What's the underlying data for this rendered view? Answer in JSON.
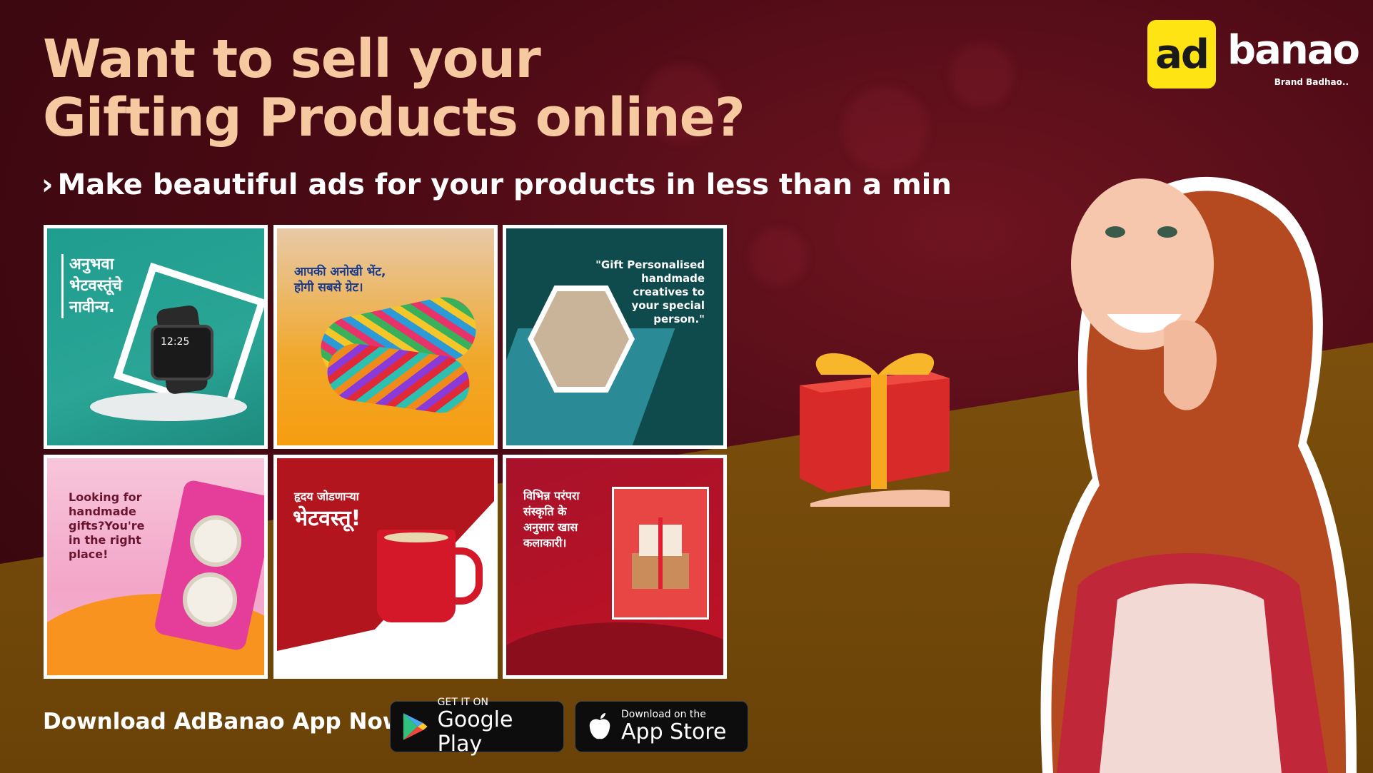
{
  "headline": {
    "line1": "Want to sell your",
    "line2": "Gifting Products online?"
  },
  "subheadline": "Make beautiful ads for your products in less than a min",
  "logo": {
    "mark": "ad",
    "word": "banao",
    "tagline": "Brand Badhao.."
  },
  "tiles": [
    {
      "text": "अनुभवा\nभेटवस्तूंचे\nनावीन्य."
    },
    {
      "text": "आपकी अनोखी भेंट,\nहोगी सबसे ग्रेट।"
    },
    {
      "text": "\"Gift Personalised\nhandmade\ncreatives to\nyour special\nperson.\""
    },
    {
      "text": "Looking for\nhandmade\ngifts?You're\nin the right\nplace!"
    },
    {
      "text_small": "हृदय जोडणाऱ्या",
      "text_big": "भेटवस्तू!"
    },
    {
      "text": "विभिन्न परंपरा\nसंस्कृति के\nअनुसार खास\nकलाकारी।"
    }
  ],
  "download": {
    "label": "Download AdBanao App Now",
    "google_play": {
      "small": "GET IT ON",
      "big": "Google Play"
    },
    "app_store": {
      "small": "Download on the",
      "big": "App Store"
    }
  },
  "colors": {
    "headline": "#f6c9a0",
    "background": "#4a0a14",
    "gold": "#8a5a0f",
    "logo_yellow": "#ffe414"
  },
  "icons": [
    "chevron-right-icon",
    "google-play-icon",
    "apple-icon"
  ]
}
